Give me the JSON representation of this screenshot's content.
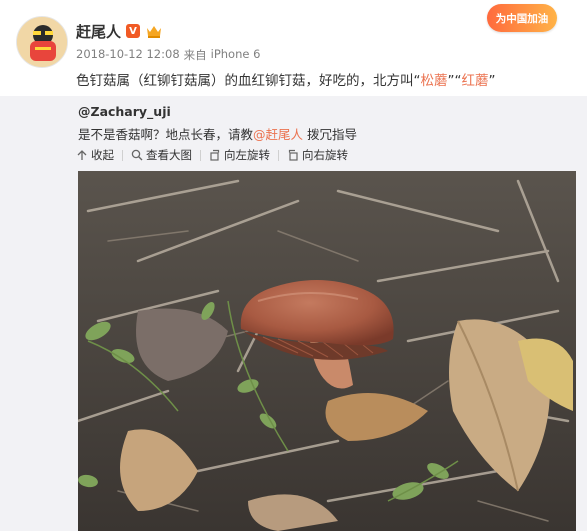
{
  "post": {
    "username": "赶尾人",
    "vip_badge": "V",
    "timestamp": "2018-10-12 12:08",
    "source_prefix": "来自",
    "source": "iPhone 6",
    "text_before": "色钉菇属（红铆钉菇属）的血红铆钉菇，好吃的，北方叫“",
    "text_hl1": "松蘑",
    "text_mid": "”“",
    "text_hl2": "红蘑",
    "text_after": "”"
  },
  "promo": {
    "label": "为中国加油"
  },
  "repost": {
    "username": "@Zachary_uji",
    "text_before": "是不是香菇啊？地点长春，请教",
    "mention": "@赶尾人",
    "text_after": " 拨冗指导"
  },
  "toolbar": {
    "collapse": "收起",
    "view_large": "查看大图",
    "rotate_left": "向左旋转",
    "rotate_right": "向右旋转"
  },
  "colors": {
    "accent": "#eb7350",
    "vip": "#f15a24",
    "repost_bg": "#f2f2f5",
    "meta_gray": "#808080"
  },
  "icons": {
    "collapse": "collapse-icon",
    "view_large": "magnifier-icon",
    "rotate_left": "rotate-left-icon",
    "rotate_right": "rotate-right-icon",
    "member": "crown-icon"
  }
}
